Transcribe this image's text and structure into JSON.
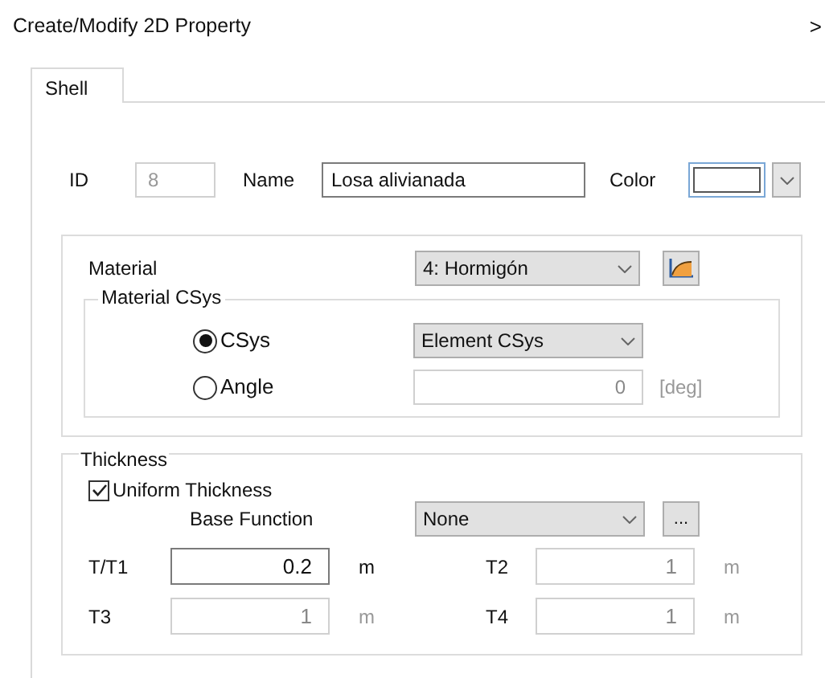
{
  "window": {
    "title": "Create/Modify 2D Property",
    "close_glyph": ">"
  },
  "tabs": [
    {
      "label": "Shell",
      "selected": true
    }
  ],
  "id_field": {
    "label": "ID",
    "value": "8",
    "disabled": true
  },
  "name_field": {
    "label": "Name",
    "value": "Losa alivianada"
  },
  "color_field": {
    "label": "Color"
  },
  "material": {
    "label": "Material",
    "value": "4: Hormigón"
  },
  "material_csys": {
    "title": "Material CSys",
    "options": [
      {
        "label": "CSys",
        "selected": true
      },
      {
        "label": "Angle",
        "selected": false
      }
    ],
    "csys_value": "Element CSys",
    "angle_value": "0",
    "angle_unit": "[deg]",
    "angle_disabled": true
  },
  "thickness": {
    "title": "Thickness",
    "uniform": {
      "label": "Uniform Thickness",
      "checked": true
    },
    "base_function": {
      "label": "Base Function",
      "value": "None",
      "more_button": "..."
    },
    "fields": [
      {
        "label": "T/T1",
        "value": "0.2",
        "unit": "m",
        "disabled": false
      },
      {
        "label": "T2",
        "value": "1",
        "unit": "m",
        "disabled": true
      },
      {
        "label": "T3",
        "value": "1",
        "unit": "m",
        "disabled": true
      },
      {
        "label": "T4",
        "value": "1",
        "unit": "m",
        "disabled": true
      }
    ]
  }
}
